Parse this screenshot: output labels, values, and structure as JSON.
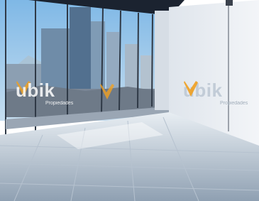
{
  "photo": {
    "subject": "office-interior",
    "colors": {
      "sky": "#8fc4ea",
      "wall": "#eef1f5",
      "floor": "#c9d3dd",
      "ceiling": "#1b2330",
      "accent_orange": "#f0a020"
    }
  },
  "watermarks": [
    {
      "brand": "ubik",
      "sub": "Propiedades"
    },
    {
      "brand": "ubik",
      "sub": "Propiedades"
    }
  ]
}
